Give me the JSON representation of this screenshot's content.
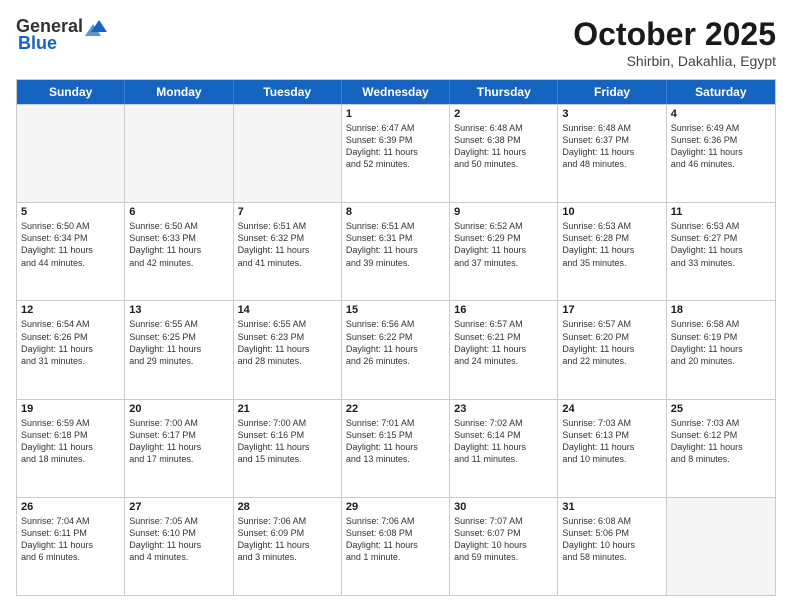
{
  "header": {
    "logo_general": "General",
    "logo_blue": "Blue",
    "month_title": "October 2025",
    "location": "Shirbin, Dakahlia, Egypt"
  },
  "weekdays": [
    "Sunday",
    "Monday",
    "Tuesday",
    "Wednesday",
    "Thursday",
    "Friday",
    "Saturday"
  ],
  "rows": [
    [
      {
        "day": "",
        "lines": [],
        "empty": true
      },
      {
        "day": "",
        "lines": [],
        "empty": true
      },
      {
        "day": "",
        "lines": [],
        "empty": true
      },
      {
        "day": "1",
        "lines": [
          "Sunrise: 6:47 AM",
          "Sunset: 6:39 PM",
          "Daylight: 11 hours",
          "and 52 minutes."
        ]
      },
      {
        "day": "2",
        "lines": [
          "Sunrise: 6:48 AM",
          "Sunset: 6:38 PM",
          "Daylight: 11 hours",
          "and 50 minutes."
        ]
      },
      {
        "day": "3",
        "lines": [
          "Sunrise: 6:48 AM",
          "Sunset: 6:37 PM",
          "Daylight: 11 hours",
          "and 48 minutes."
        ]
      },
      {
        "day": "4",
        "lines": [
          "Sunrise: 6:49 AM",
          "Sunset: 6:36 PM",
          "Daylight: 11 hours",
          "and 46 minutes."
        ]
      }
    ],
    [
      {
        "day": "5",
        "lines": [
          "Sunrise: 6:50 AM",
          "Sunset: 6:34 PM",
          "Daylight: 11 hours",
          "and 44 minutes."
        ]
      },
      {
        "day": "6",
        "lines": [
          "Sunrise: 6:50 AM",
          "Sunset: 6:33 PM",
          "Daylight: 11 hours",
          "and 42 minutes."
        ]
      },
      {
        "day": "7",
        "lines": [
          "Sunrise: 6:51 AM",
          "Sunset: 6:32 PM",
          "Daylight: 11 hours",
          "and 41 minutes."
        ]
      },
      {
        "day": "8",
        "lines": [
          "Sunrise: 6:51 AM",
          "Sunset: 6:31 PM",
          "Daylight: 11 hours",
          "and 39 minutes."
        ]
      },
      {
        "day": "9",
        "lines": [
          "Sunrise: 6:52 AM",
          "Sunset: 6:29 PM",
          "Daylight: 11 hours",
          "and 37 minutes."
        ]
      },
      {
        "day": "10",
        "lines": [
          "Sunrise: 6:53 AM",
          "Sunset: 6:28 PM",
          "Daylight: 11 hours",
          "and 35 minutes."
        ]
      },
      {
        "day": "11",
        "lines": [
          "Sunrise: 6:53 AM",
          "Sunset: 6:27 PM",
          "Daylight: 11 hours",
          "and 33 minutes."
        ]
      }
    ],
    [
      {
        "day": "12",
        "lines": [
          "Sunrise: 6:54 AM",
          "Sunset: 6:26 PM",
          "Daylight: 11 hours",
          "and 31 minutes."
        ]
      },
      {
        "day": "13",
        "lines": [
          "Sunrise: 6:55 AM",
          "Sunset: 6:25 PM",
          "Daylight: 11 hours",
          "and 29 minutes."
        ]
      },
      {
        "day": "14",
        "lines": [
          "Sunrise: 6:55 AM",
          "Sunset: 6:23 PM",
          "Daylight: 11 hours",
          "and 28 minutes."
        ]
      },
      {
        "day": "15",
        "lines": [
          "Sunrise: 6:56 AM",
          "Sunset: 6:22 PM",
          "Daylight: 11 hours",
          "and 26 minutes."
        ]
      },
      {
        "day": "16",
        "lines": [
          "Sunrise: 6:57 AM",
          "Sunset: 6:21 PM",
          "Daylight: 11 hours",
          "and 24 minutes."
        ]
      },
      {
        "day": "17",
        "lines": [
          "Sunrise: 6:57 AM",
          "Sunset: 6:20 PM",
          "Daylight: 11 hours",
          "and 22 minutes."
        ]
      },
      {
        "day": "18",
        "lines": [
          "Sunrise: 6:58 AM",
          "Sunset: 6:19 PM",
          "Daylight: 11 hours",
          "and 20 minutes."
        ]
      }
    ],
    [
      {
        "day": "19",
        "lines": [
          "Sunrise: 6:59 AM",
          "Sunset: 6:18 PM",
          "Daylight: 11 hours",
          "and 18 minutes."
        ]
      },
      {
        "day": "20",
        "lines": [
          "Sunrise: 7:00 AM",
          "Sunset: 6:17 PM",
          "Daylight: 11 hours",
          "and 17 minutes."
        ]
      },
      {
        "day": "21",
        "lines": [
          "Sunrise: 7:00 AM",
          "Sunset: 6:16 PM",
          "Daylight: 11 hours",
          "and 15 minutes."
        ]
      },
      {
        "day": "22",
        "lines": [
          "Sunrise: 7:01 AM",
          "Sunset: 6:15 PM",
          "Daylight: 11 hours",
          "and 13 minutes."
        ]
      },
      {
        "day": "23",
        "lines": [
          "Sunrise: 7:02 AM",
          "Sunset: 6:14 PM",
          "Daylight: 11 hours",
          "and 11 minutes."
        ]
      },
      {
        "day": "24",
        "lines": [
          "Sunrise: 7:03 AM",
          "Sunset: 6:13 PM",
          "Daylight: 11 hours",
          "and 10 minutes."
        ]
      },
      {
        "day": "25",
        "lines": [
          "Sunrise: 7:03 AM",
          "Sunset: 6:12 PM",
          "Daylight: 11 hours",
          "and 8 minutes."
        ]
      }
    ],
    [
      {
        "day": "26",
        "lines": [
          "Sunrise: 7:04 AM",
          "Sunset: 6:11 PM",
          "Daylight: 11 hours",
          "and 6 minutes."
        ]
      },
      {
        "day": "27",
        "lines": [
          "Sunrise: 7:05 AM",
          "Sunset: 6:10 PM",
          "Daylight: 11 hours",
          "and 4 minutes."
        ]
      },
      {
        "day": "28",
        "lines": [
          "Sunrise: 7:06 AM",
          "Sunset: 6:09 PM",
          "Daylight: 11 hours",
          "and 3 minutes."
        ]
      },
      {
        "day": "29",
        "lines": [
          "Sunrise: 7:06 AM",
          "Sunset: 6:08 PM",
          "Daylight: 11 hours",
          "and 1 minute."
        ]
      },
      {
        "day": "30",
        "lines": [
          "Sunrise: 7:07 AM",
          "Sunset: 6:07 PM",
          "Daylight: 10 hours",
          "and 59 minutes."
        ]
      },
      {
        "day": "31",
        "lines": [
          "Sunrise: 6:08 AM",
          "Sunset: 5:06 PM",
          "Daylight: 10 hours",
          "and 58 minutes."
        ]
      },
      {
        "day": "",
        "lines": [],
        "empty": true
      }
    ]
  ]
}
